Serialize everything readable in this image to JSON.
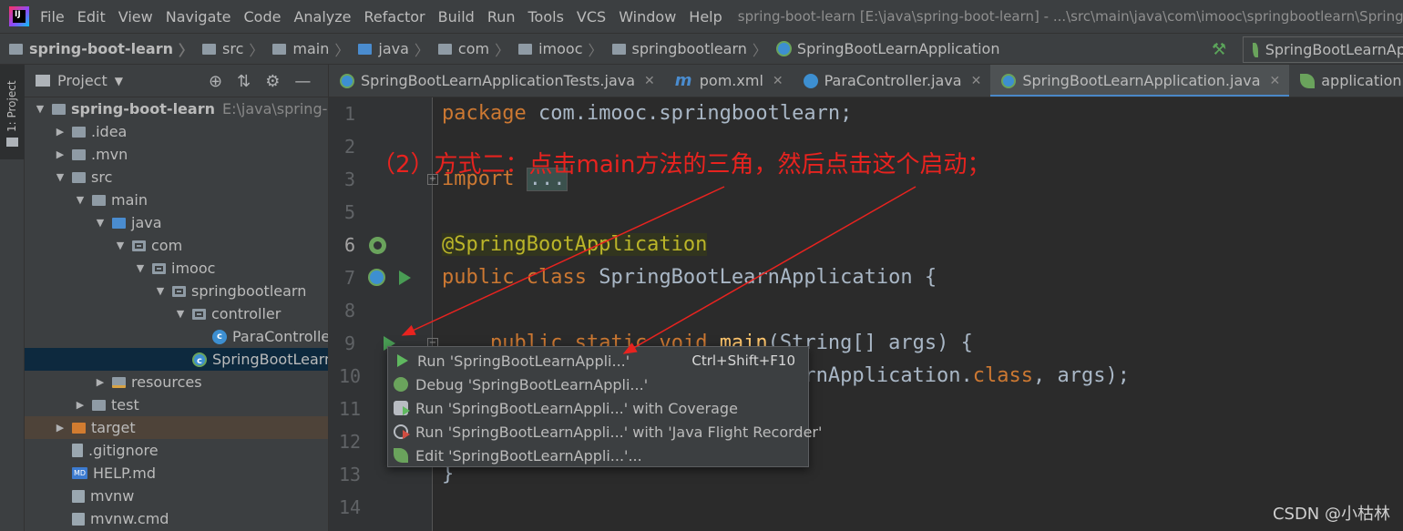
{
  "menubar": {
    "app_icon": "intellij-idea-icon",
    "items": [
      "File",
      "Edit",
      "View",
      "Navigate",
      "Code",
      "Analyze",
      "Refactor",
      "Build",
      "Run",
      "Tools",
      "VCS",
      "Window",
      "Help"
    ],
    "window_title": "spring-boot-learn [E:\\java\\spring-boot-learn] - ...\\src\\main\\java\\com\\imooc\\springbootlearn\\SpringBoo"
  },
  "navbar": {
    "crumbs": [
      "spring-boot-learn",
      "src",
      "main",
      "java",
      "com",
      "imooc",
      "springbootlearn",
      "SpringBootLearnApplication"
    ],
    "run_config": "SpringBootLearnAp"
  },
  "toolstrip": {
    "project_tab": "1: Project"
  },
  "panel": {
    "title": "Project",
    "tree": [
      {
        "label": "spring-boot-learn",
        "extra": "E:\\java\\spring-boot-",
        "indent": 0,
        "arrow": "down",
        "icon": "folder"
      },
      {
        "label": ".idea",
        "indent": 1,
        "arrow": "right",
        "icon": "folder"
      },
      {
        "label": ".mvn",
        "indent": 1,
        "arrow": "right",
        "icon": "folder"
      },
      {
        "label": "src",
        "indent": 1,
        "arrow": "down",
        "icon": "folder"
      },
      {
        "label": "main",
        "indent": 2,
        "arrow": "down",
        "icon": "folder"
      },
      {
        "label": "java",
        "indent": 3,
        "arrow": "down",
        "icon": "src"
      },
      {
        "label": "com",
        "indent": 4,
        "arrow": "down",
        "icon": "pkg"
      },
      {
        "label": "imooc",
        "indent": 5,
        "arrow": "down",
        "icon": "pkg"
      },
      {
        "label": "springbootlearn",
        "indent": 6,
        "arrow": "down",
        "icon": "pkg"
      },
      {
        "label": "controller",
        "indent": 7,
        "arrow": "down",
        "icon": "pkg"
      },
      {
        "label": "ParaController",
        "indent": 8,
        "arrow": "none",
        "icon": "cls"
      },
      {
        "label": "SpringBootLearnA",
        "indent": 7,
        "arrow": "none",
        "icon": "cls-spring",
        "selected": true
      },
      {
        "label": "resources",
        "indent": 3,
        "arrow": "right",
        "icon": "res"
      },
      {
        "label": "test",
        "indent": 2,
        "arrow": "right",
        "icon": "folder"
      },
      {
        "label": "target",
        "indent": 1,
        "arrow": "right",
        "icon": "target",
        "excluded": true
      },
      {
        "label": ".gitignore",
        "indent": 1,
        "arrow": "none",
        "icon": "file"
      },
      {
        "label": "HELP.md",
        "indent": 1,
        "arrow": "none",
        "icon": "md"
      },
      {
        "label": "mvnw",
        "indent": 1,
        "arrow": "none",
        "icon": "term"
      },
      {
        "label": "mvnw.cmd",
        "indent": 1,
        "arrow": "none",
        "icon": "term"
      }
    ]
  },
  "tabs": [
    {
      "label": "SpringBootLearnApplicationTests.java",
      "icon": "spring-class-icon",
      "active": false
    },
    {
      "label": "pom.xml",
      "icon": "maven-icon",
      "active": false
    },
    {
      "label": "ParaController.java",
      "icon": "class-icon",
      "active": false
    },
    {
      "label": "SpringBootLearnApplication.java",
      "icon": "spring-class-icon",
      "active": true
    },
    {
      "label": "application.properties",
      "icon": "properties-icon",
      "active": false
    }
  ],
  "editor": {
    "line_numbers": [
      "1",
      "2",
      "3",
      "5",
      "6",
      "7",
      "8",
      "9",
      "10",
      "11",
      "12",
      "13",
      "14"
    ],
    "line1": {
      "kw": "package",
      "rest": " com.imooc.springbootlearn;"
    },
    "line3": {
      "kw": "import",
      "folded": "..."
    },
    "line6": {
      "annotation": "@SpringBootApplication"
    },
    "line7": {
      "kw1": "public",
      "kw2": "class",
      "rest": " SpringBootLearnApplication {"
    },
    "line9": {
      "kw1": "public",
      "kw2": "static",
      "kw3": "void",
      "fn": "main",
      "rest": "(String[] args) {"
    },
    "line10": {
      "rest_a": "(SpringBootLearnApplication.",
      "kw": "class",
      "rest_b": ", args);"
    },
    "line13": {
      "rest": "}"
    }
  },
  "popup": {
    "items": [
      {
        "label": "Run 'SpringBootLearnAppli...'",
        "shortcut": "Ctrl+Shift+F10",
        "icon": "run-icon"
      },
      {
        "label": "Debug 'SpringBootLearnAppli...'",
        "shortcut": "",
        "icon": "debug-icon"
      },
      {
        "label": "Run 'SpringBootLearnAppli...' with Coverage",
        "shortcut": "",
        "icon": "coverage-icon"
      },
      {
        "label": "Run 'SpringBootLearnAppli...' with 'Java Flight Recorder'",
        "shortcut": "",
        "icon": "flight-recorder-icon"
      },
      {
        "label": "Edit 'SpringBootLearnAppli...'...",
        "shortcut": "",
        "icon": "edit-config-icon"
      }
    ]
  },
  "annotation": {
    "text": "（2）方式二：点击main方法的三角，然后点击这个启动；",
    "color": "#e8231f"
  },
  "watermark": "CSDN @小枯林",
  "colors": {
    "keyword": "#cc7832",
    "annotation": "#bbb529",
    "function": "#ffc66d",
    "identifier": "#a9b7c6",
    "selection": "#2f65ca",
    "run_green": "#499c54"
  }
}
